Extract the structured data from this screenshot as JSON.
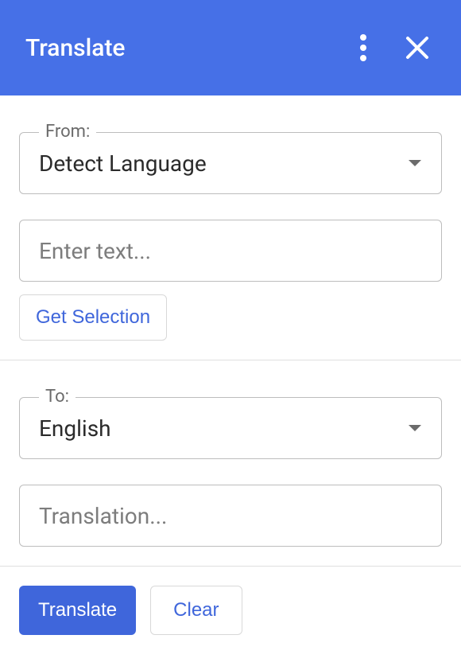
{
  "header": {
    "title": "Translate"
  },
  "from": {
    "label": "From:",
    "selected": "Detect Language",
    "input_placeholder": "Enter text...",
    "get_selection_label": "Get Selection"
  },
  "to": {
    "label": "To:",
    "selected": "English",
    "output_placeholder": "Translation..."
  },
  "footer": {
    "translate_label": "Translate",
    "clear_label": "Clear"
  }
}
